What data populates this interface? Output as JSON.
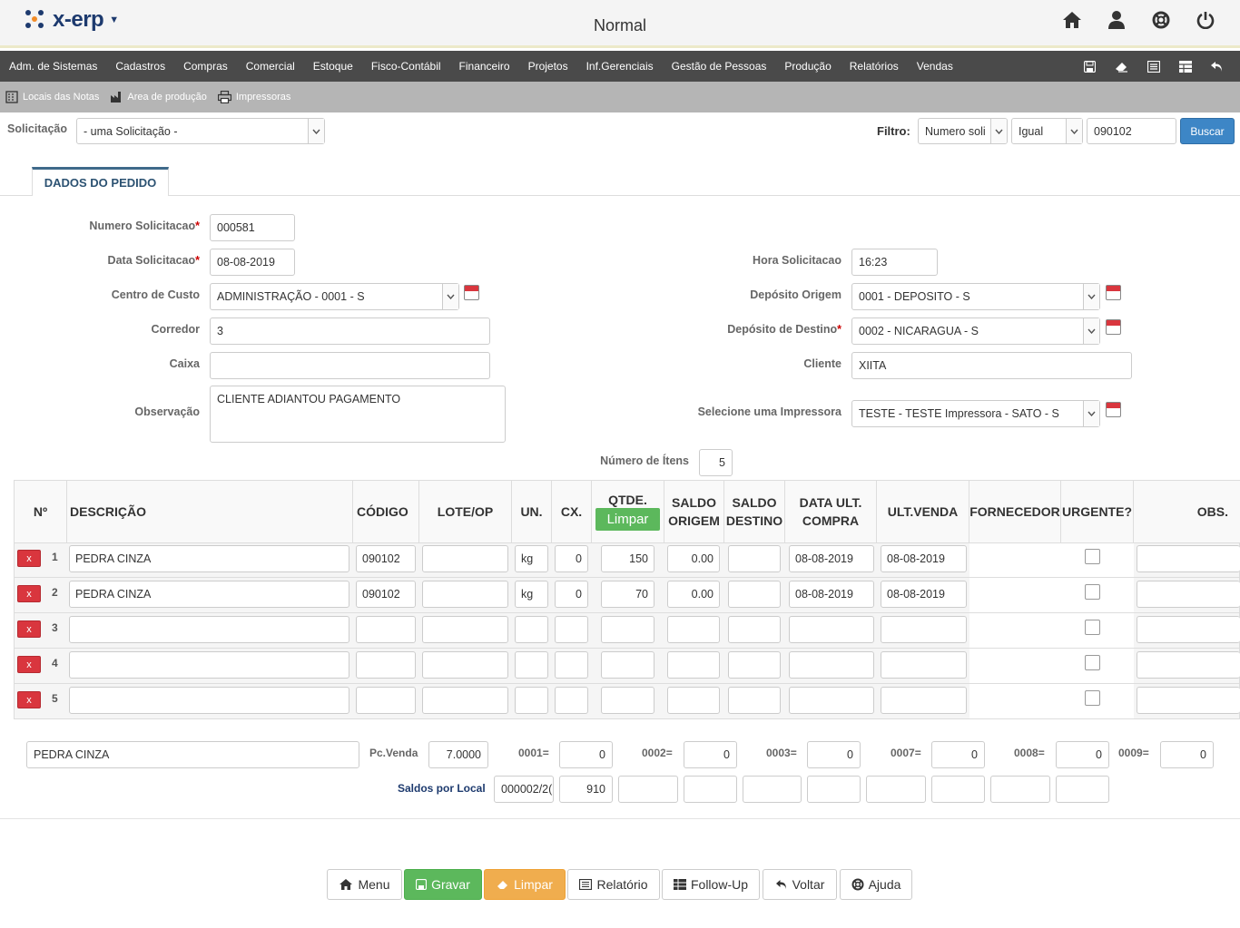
{
  "app": {
    "logo_text": "x-erp",
    "mode": "Normal"
  },
  "menu": {
    "items": [
      "Adm. de Sistemas",
      "Cadastros",
      "Compras",
      "Comercial",
      "Estoque",
      "Fisco-Contábil",
      "Financeiro",
      "Projetos",
      "Inf.Gerenciais",
      "Gestão de Pessoas",
      "Produção",
      "Relatórios",
      "Vendas"
    ]
  },
  "subtoolbar": {
    "items": [
      "Locais das Notas",
      "Area de produção",
      "Impressoras"
    ]
  },
  "search": {
    "solicitacao_label": "Solicitação",
    "solicitacao_value": "- uma Solicitação -",
    "filtro_label": "Filtro:",
    "filtro_field": "Numero soli",
    "filtro_op": "Igual",
    "filtro_value": "090102",
    "buscar_label": "Buscar"
  },
  "tab": {
    "label": "DADOS DO PEDIDO"
  },
  "form": {
    "numero_label": "Numero Solicitacao",
    "numero_value": "000581",
    "data_label": "Data Solicitacao",
    "data_value": "08-08-2019",
    "hora_label": "Hora Solicitacao",
    "hora_value": "16:23",
    "centro_label": "Centro de Custo",
    "centro_value": "ADMINISTRAÇÃO - 0001 - S",
    "deposito_origem_label": "Depósito Origem",
    "deposito_origem_value": "0001 - DEPOSITO - S",
    "corredor_label": "Corredor",
    "corredor_value": "3",
    "deposito_destino_label": "Depósito de Destino",
    "deposito_destino_value": "0002 - NICARAGUA - S",
    "caixa_label": "Caixa",
    "caixa_value": "",
    "cliente_label": "Cliente",
    "cliente_value": "XIITA",
    "obs_label": "Observação",
    "obs_value": "CLIENTE ADIANTOU PAGAMENTO",
    "impressora_label": "Selecione uma Impressora",
    "impressora_value": "TESTE - TESTE Impressora - SATO - S",
    "num_itens_label": "Número de Ítens",
    "num_itens_value": "5",
    "required_mark": "*"
  },
  "grid": {
    "headers": [
      "Nº",
      "DESCRIÇÃO",
      "CÓDIGO",
      "LOTE/OP",
      "UN.",
      "CX.",
      "QTDE.",
      "SALDO ORIGEM",
      "SALDO DESTINO",
      "DATA ULT. COMPRA",
      "ULT.VENDA",
      "FORNECEDOR",
      "URGENTE?",
      "OBS."
    ],
    "limpar_label": "Limpar",
    "delete_label": "x",
    "rows": [
      {
        "n": "1",
        "desc": "PEDRA CINZA",
        "codigo": "090102",
        "lote": "",
        "un": "kg",
        "cx": "0",
        "qtde": "150",
        "saldo_origem": "0.00",
        "saldo_destino": "",
        "data_compra": "08-08-2019",
        "ult_venda": "08-08-2019"
      },
      {
        "n": "2",
        "desc": "PEDRA CINZA",
        "codigo": "090102",
        "lote": "",
        "un": "kg",
        "cx": "0",
        "qtde": "70",
        "saldo_origem": "0.00",
        "saldo_destino": "",
        "data_compra": "08-08-2019",
        "ult_venda": "08-08-2019"
      },
      {
        "n": "3",
        "desc": "",
        "codigo": "",
        "lote": "",
        "un": "",
        "cx": "",
        "qtde": "",
        "saldo_origem": "",
        "saldo_destino": "",
        "data_compra": "",
        "ult_venda": ""
      },
      {
        "n": "4",
        "desc": "",
        "codigo": "",
        "lote": "",
        "un": "",
        "cx": "",
        "qtde": "",
        "saldo_origem": "",
        "saldo_destino": "",
        "data_compra": "",
        "ult_venda": ""
      },
      {
        "n": "5",
        "desc": "",
        "codigo": "",
        "lote": "",
        "un": "",
        "cx": "",
        "qtde": "",
        "saldo_origem": "",
        "saldo_destino": "",
        "data_compra": "",
        "ult_venda": ""
      }
    ]
  },
  "summary": {
    "produto": "PEDRA CINZA",
    "pcvenda_label": "Pc.Venda",
    "pcvenda_value": "7.0000",
    "locais": [
      {
        "label": "0001=",
        "value": "0"
      },
      {
        "label": "0002=",
        "value": "0"
      },
      {
        "label": "0003=",
        "value": "0"
      },
      {
        "label": "0007=",
        "value": "0"
      },
      {
        "label": "0008=",
        "value": "0"
      },
      {
        "label": "0009=",
        "value": "0"
      }
    ],
    "saldos_label": "Saldos por Local",
    "saldos_code": "000002/2(",
    "saldos_value": "910"
  },
  "buttons": {
    "menu": "Menu",
    "gravar": "Gravar",
    "limpar": "Limpar",
    "relatorio": "Relatório",
    "followup": "Follow-Up",
    "voltar": "Voltar",
    "ajuda": "Ajuda"
  },
  "colors": {
    "menubar": "#4a4a4a",
    "gravar": "#5cb85c",
    "limpar": "#f0ad4e",
    "buscar": "#3d86c6",
    "delete": "#d9363e"
  }
}
